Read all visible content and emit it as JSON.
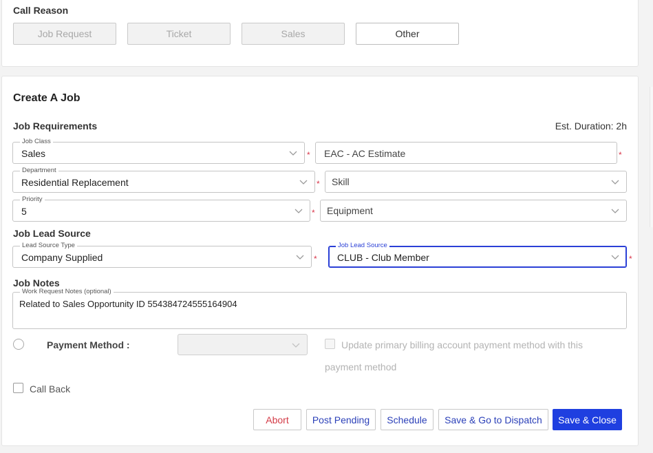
{
  "call_reason": {
    "title": "Call Reason",
    "options": [
      {
        "label": "Job Request",
        "active": false
      },
      {
        "label": "Ticket",
        "active": false
      },
      {
        "label": "Sales",
        "active": false
      },
      {
        "label": "Other",
        "active": true
      }
    ]
  },
  "create_job": {
    "title": "Create A Job",
    "requirements": {
      "title": "Job Requirements",
      "est_duration": "Est. Duration: 2h",
      "job_class": {
        "label": "Job Class",
        "value": "Sales"
      },
      "job_type": {
        "value": "EAC - AC Estimate"
      },
      "department": {
        "label": "Department",
        "value": "Residential Replacement"
      },
      "skill": {
        "placeholder": "Skill"
      },
      "priority": {
        "label": "Priority",
        "value": "5"
      },
      "equipment": {
        "placeholder": "Equipment"
      }
    },
    "lead_source": {
      "title": "Job Lead Source",
      "type": {
        "label": "Lead Source Type",
        "value": "Company Supplied"
      },
      "source": {
        "label": "Job Lead Source",
        "value": "CLUB - Club Member"
      }
    },
    "notes": {
      "title": "Job Notes",
      "label": "Work Request Notes (optional)",
      "value": "Related to Sales Opportunity ID 554384724555164904"
    },
    "payment": {
      "label": "Payment Method :",
      "update_line1": "Update primary billing account payment method with this",
      "update_line2": "payment method"
    },
    "call_back": {
      "label": "Call Back"
    },
    "actions": {
      "abort": "Abort",
      "post_pending": "Post Pending",
      "schedule": "Schedule",
      "save_dispatch": "Save & Go to Dispatch",
      "save_close": "Save & Close"
    }
  },
  "colors": {
    "primary": "#1f3fe0",
    "required": "#d9364a",
    "abort": "#d33a46",
    "link": "#2a3fb8"
  }
}
